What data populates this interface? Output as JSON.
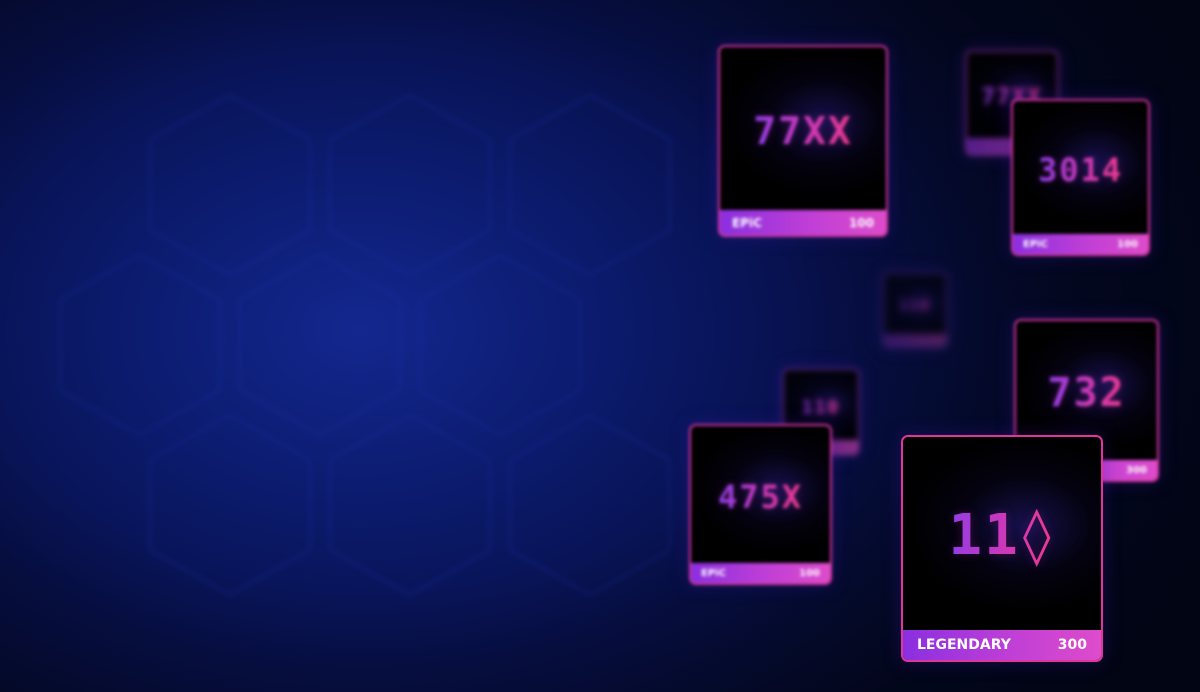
{
  "background": {
    "colors": {
      "center": "#13278f",
      "mid": "#0b1a6b",
      "edge": "#040a2c"
    }
  },
  "cards": [
    {
      "id": "card-ghost-top",
      "number": "77XX",
      "rarity": "",
      "value": ""
    },
    {
      "id": "card-7788",
      "number": "77XX",
      "rarity": "EPiC",
      "value": "100"
    },
    {
      "id": "card-3014",
      "number": "3014",
      "rarity": "EPiC",
      "value": "100"
    },
    {
      "id": "card-ghost-mid",
      "number": "110",
      "rarity": "",
      "value": ""
    },
    {
      "id": "card-ghost-low",
      "number": "110",
      "rarity": "",
      "value": ""
    },
    {
      "id": "card-732",
      "number": "732",
      "rarity": "",
      "value": "300"
    },
    {
      "id": "card-4758",
      "number": "475X",
      "rarity": "EPiC",
      "value": "100"
    },
    {
      "id": "card-110",
      "number": "11◊",
      "rarity": "LEGENDARY",
      "value": "300"
    }
  ],
  "colors": {
    "card_border": "#d1349e",
    "bar_start": "#8a2fe0",
    "bar_end": "#dd4ccb",
    "number_start": "#8a3ff0",
    "number_end": "#f23a8a"
  }
}
